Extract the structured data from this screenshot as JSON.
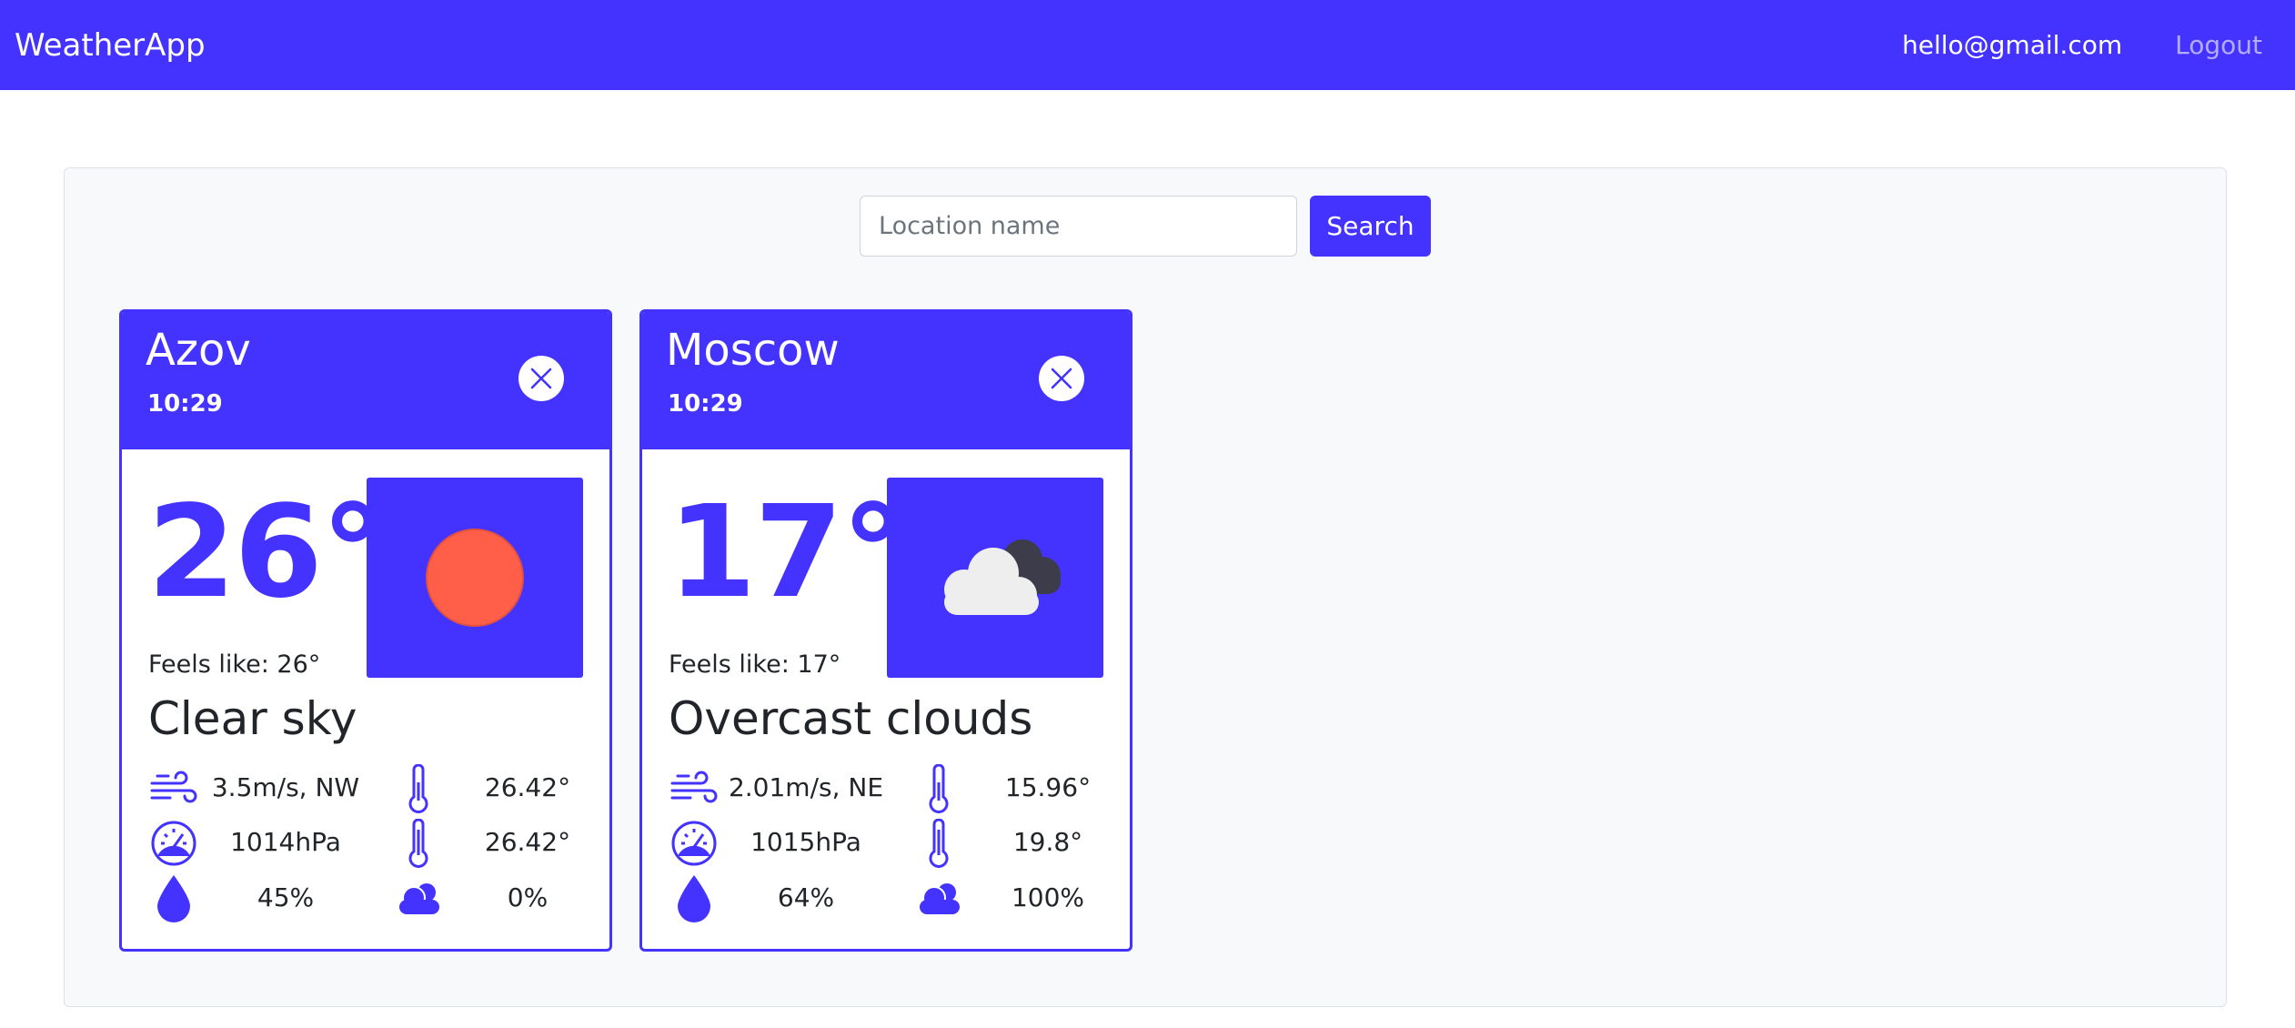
{
  "navbar": {
    "brand": "WeatherApp",
    "email": "hello@gmail.com",
    "logout": "Logout"
  },
  "search": {
    "placeholder": "Location name",
    "value": "",
    "button": "Search"
  },
  "cards": [
    {
      "city": "Azov",
      "time": "10:29",
      "temperature": "26°",
      "feels_like": "Feels like: 26°",
      "description": "Clear sky",
      "weather_icon": "sun-icon",
      "wind": "3.5m/s, NW",
      "temp_min": "26.42°",
      "pressure": "1014hPa",
      "temp_max": "26.42°",
      "humidity": "45%",
      "clouds": "0%"
    },
    {
      "city": "Moscow",
      "time": "10:29",
      "temperature": "17°",
      "feels_like": "Feels like: 17°",
      "description": "Overcast clouds",
      "weather_icon": "overcast-clouds-icon",
      "wind": "2.01m/s, NE",
      "temp_min": "15.96°",
      "pressure": "1015hPa",
      "temp_max": "19.8°",
      "humidity": "64%",
      "clouds": "100%"
    }
  ],
  "colors": {
    "accent": "#4433ff",
    "sun": "#ff5e48",
    "panel_bg": "#f8f9fa"
  }
}
